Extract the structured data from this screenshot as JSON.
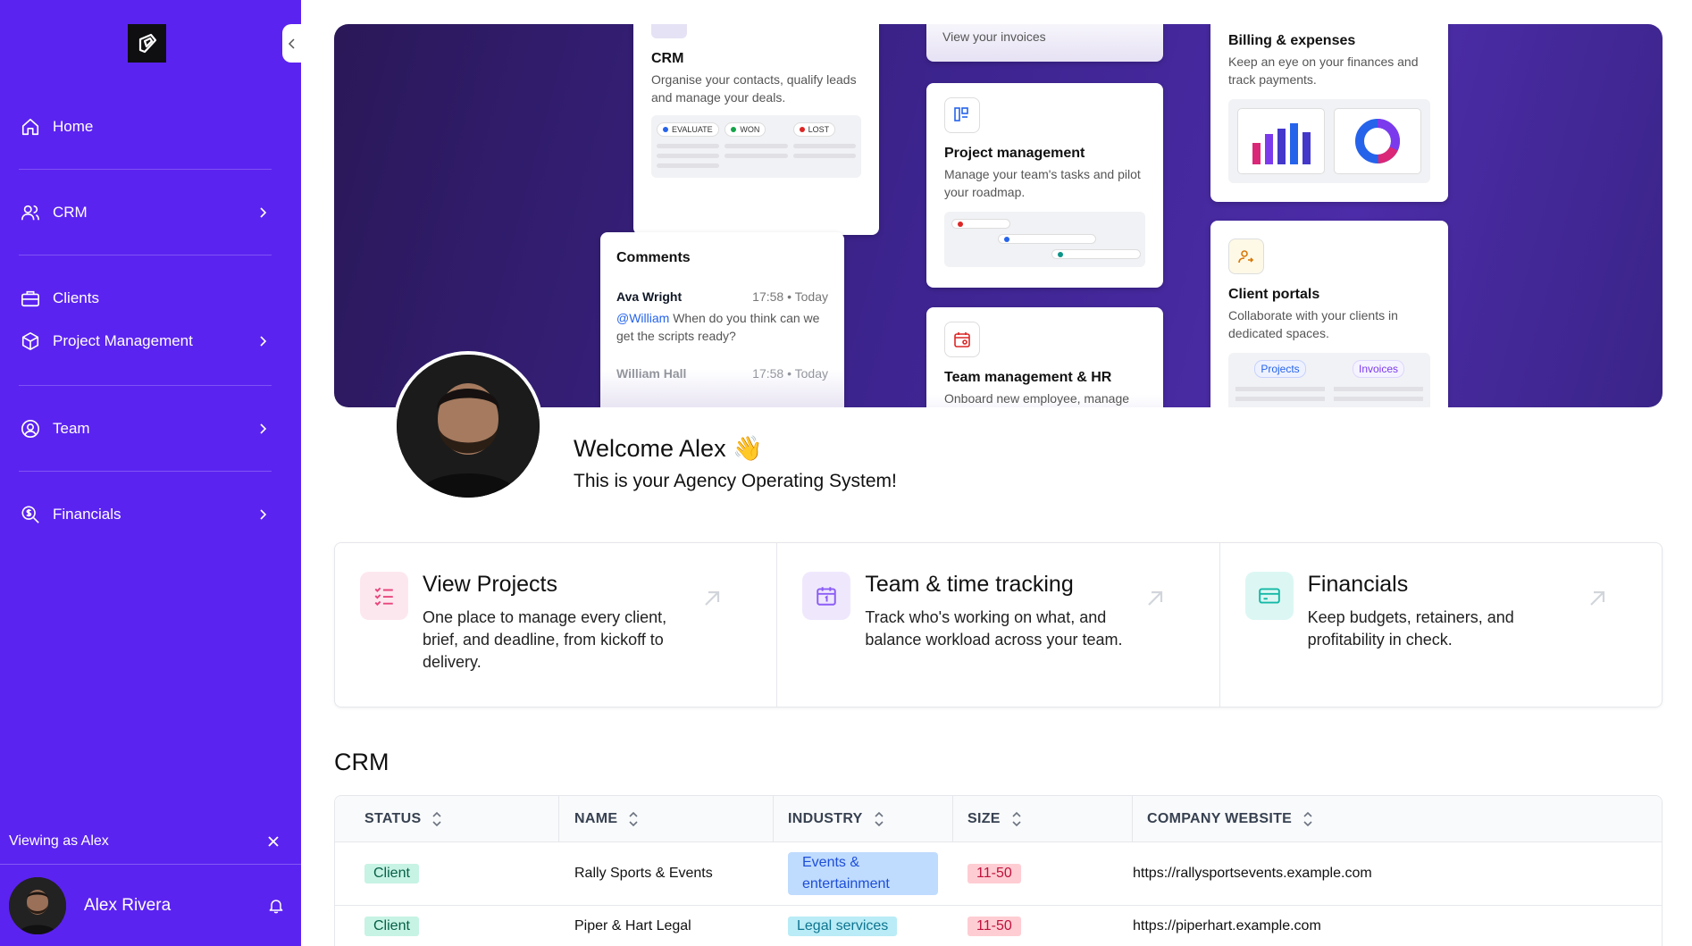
{
  "sidebar": {
    "logo_icon": "brand-logo-icon",
    "collapse_icon": "chevron-left-icon",
    "items": [
      {
        "label": "Home",
        "icon": "home-icon",
        "has_chevron": false
      },
      {
        "label": "CRM",
        "icon": "users-icon",
        "has_chevron": true
      },
      {
        "label": "Clients",
        "icon": "briefcase-icon",
        "has_chevron": false
      },
      {
        "label": "Project Management",
        "icon": "box-icon",
        "has_chevron": true
      },
      {
        "label": "Team",
        "icon": "user-circle-icon",
        "has_chevron": true
      },
      {
        "label": "Financials",
        "icon": "search-dollar-icon",
        "has_chevron": true
      }
    ],
    "viewing_text": "Viewing as Alex",
    "user_name": "Alex Rivera",
    "accent": "#5b23f0"
  },
  "hero": {
    "crm": {
      "title": "CRM",
      "desc": "Organise your contacts, qualify leads and manage your deals.",
      "pills": [
        "EVALUATE",
        "WON",
        "LOST"
      ]
    },
    "comments": {
      "title": "Comments",
      "author1": "Ava Wright",
      "time1": "17:58 • Today",
      "mention": "@William",
      "text1": " When do you think can we get the scripts ready?",
      "author2": "William Hall",
      "time2": "17:58 • Today"
    },
    "invoices_text": "View your invoices",
    "project": {
      "title": "Project management",
      "desc": "Manage your team's tasks and pilot your roadmap."
    },
    "team": {
      "title": "Team management & HR",
      "desc": "Onboard new employee, manage"
    },
    "billing": {
      "title": "Billing & expenses",
      "desc": "Keep an eye on your finances and track payments."
    },
    "portals": {
      "title": "Client portals",
      "desc": "Collaborate with your clients in dedicated spaces.",
      "tab1": "Projects",
      "tab2": "Invoices"
    }
  },
  "welcome": {
    "title": "Welcome Alex 👋",
    "subtitle": "This is your Agency Operating System!"
  },
  "features": [
    {
      "title": "View Projects",
      "desc": "One place to manage every client, brief, and deadline, from kickoff to delivery.",
      "icon": "checklist-icon",
      "color": "#e8467c",
      "bg": "#fde7ef"
    },
    {
      "title": "Team & time tracking",
      "desc": "Track who's working on what, and balance workload across your team.",
      "icon": "calendar-icon",
      "color": "#8b5cf6",
      "bg": "#efe8fd"
    },
    {
      "title": "Financials",
      "desc": "Keep budgets, retainers, and profitability in check.",
      "icon": "credit-card-icon",
      "color": "#14b8a6",
      "bg": "#dcf7f3"
    }
  ],
  "crm": {
    "title": "CRM",
    "columns": [
      "STATUS",
      "NAME",
      "INDUSTRY",
      "SIZE",
      "COMPANY WEBSITE"
    ],
    "rows": [
      {
        "status": "Client",
        "name": "Rally Sports & Events",
        "industry": "Events & entertainment",
        "size": "11-50",
        "website": "https://rallysportsevents.example.com"
      },
      {
        "status": "Client",
        "name": "Piper & Hart Legal",
        "industry": "Legal services",
        "size": "11-50",
        "website": "https://piperhart.example.com"
      }
    ]
  }
}
